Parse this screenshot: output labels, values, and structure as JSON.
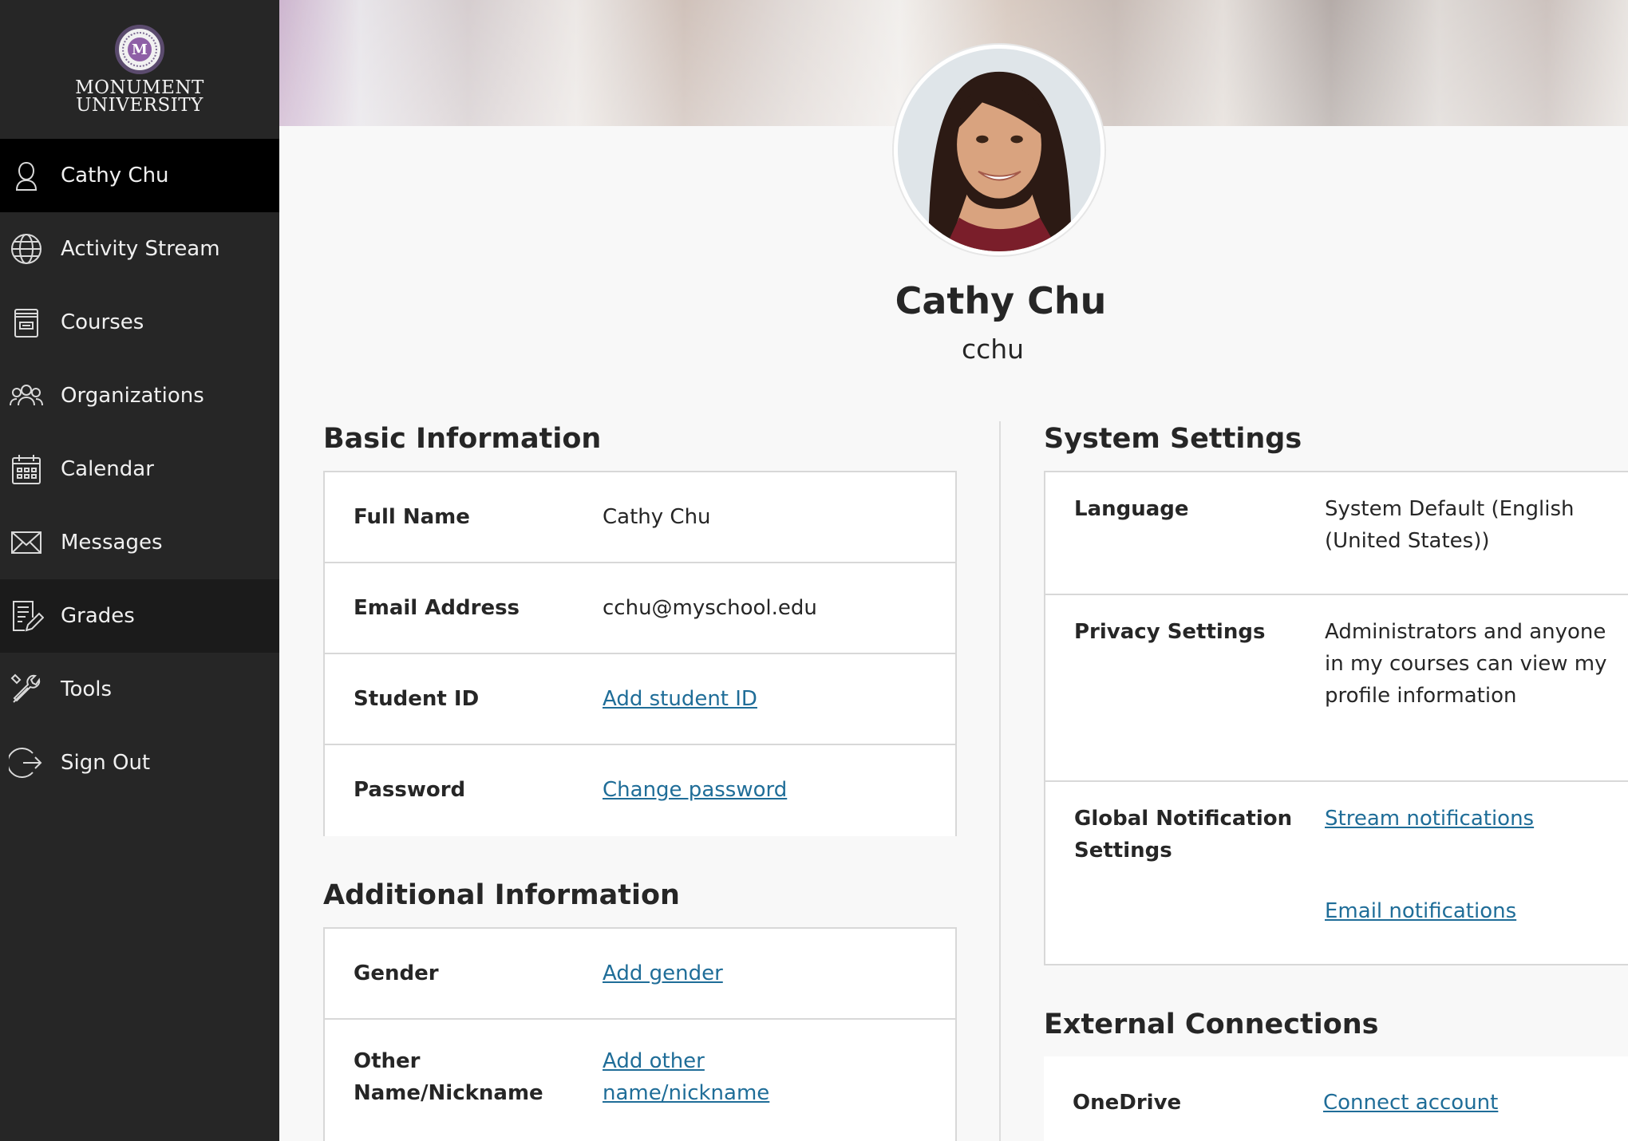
{
  "brand": {
    "line1": "MONUMENT",
    "line2": "UNIVERSITY",
    "seal_letter": "M"
  },
  "nav": {
    "items": [
      {
        "label": "Cathy Chu",
        "icon": "person-icon"
      },
      {
        "label": "Activity Stream",
        "icon": "globe-icon"
      },
      {
        "label": "Courses",
        "icon": "course-icon"
      },
      {
        "label": "Organizations",
        "icon": "group-icon"
      },
      {
        "label": "Calendar",
        "icon": "calendar-icon"
      },
      {
        "label": "Messages",
        "icon": "envelope-icon"
      },
      {
        "label": "Grades",
        "icon": "grades-icon"
      },
      {
        "label": "Tools",
        "icon": "tools-icon"
      },
      {
        "label": "Sign Out",
        "icon": "sign-out-icon"
      }
    ],
    "active_index": 0
  },
  "profile": {
    "name": "Cathy Chu",
    "username": "cchu"
  },
  "basic_info": {
    "title": "Basic Information",
    "rows": [
      {
        "label": "Full Name",
        "value": "Cathy Chu"
      },
      {
        "label": "Email Address",
        "value": "cchu@myschool.edu"
      },
      {
        "label": "Student ID",
        "link": "Add student ID"
      },
      {
        "label": "Password",
        "link": "Change password"
      }
    ]
  },
  "additional_info": {
    "title": "Additional Information",
    "rows": [
      {
        "label": "Gender",
        "link": "Add gender"
      },
      {
        "label": "Other Name/Nickname",
        "link": "Add other name/nickname"
      }
    ]
  },
  "system_settings": {
    "title": "System Settings",
    "rows": [
      {
        "label": "Language",
        "value": "System Default (English (United States))"
      },
      {
        "label": "Privacy Settings",
        "value": "Administrators and anyone in my courses can view my profile information"
      },
      {
        "label": "Global Notification Settings",
        "link1": "Stream notifications",
        "link2": "Email notifications"
      }
    ]
  },
  "external_connections": {
    "title": "External Connections",
    "rows": [
      {
        "label": "OneDrive",
        "link": "Connect account"
      }
    ]
  },
  "colors": {
    "sidebar": "#262626",
    "active_nav": "#000000",
    "link": "#1f6d98",
    "page_bg": "#f8f8f8"
  }
}
